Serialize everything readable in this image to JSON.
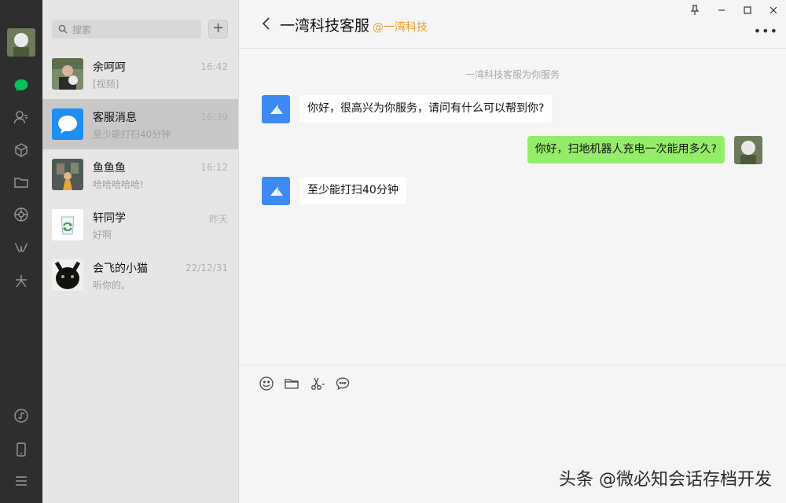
{
  "nav": {
    "icons": [
      "chat-icon",
      "contacts-icon",
      "box-icon",
      "folder-icon",
      "moments-icon",
      "channels-icon",
      "sparkle-icon",
      "mini-program-icon",
      "phone-icon",
      "menu-icon"
    ],
    "active_color": "#07c160"
  },
  "list": {
    "search_placeholder": "搜索",
    "add_label": "+",
    "items": [
      {
        "name": "余呵呵",
        "time": "16:42",
        "preview": "[视频]"
      },
      {
        "name": "客服消息",
        "time": "16:39",
        "preview": "至少能打扫40分钟"
      },
      {
        "name": "鱼鱼鱼",
        "time": "16:12",
        "preview": "哈哈哈哈哈!"
      },
      {
        "name": "轩同学",
        "time": "昨天",
        "preview": "好啊"
      },
      {
        "name": "会飞的小猫",
        "time": "22/12/31",
        "preview": "听你的。"
      }
    ]
  },
  "chat": {
    "title": "一湾科技客服",
    "org": "@一湾科技",
    "org_color": "#f39c2b",
    "system_note": "一湾科技客服为你服务",
    "messages": [
      {
        "from": "bot",
        "text": "你好，很高兴为你服务，请问有什么可以帮到你?"
      },
      {
        "from": "me",
        "text": "你好，扫地机器人充电一次能用多久?"
      },
      {
        "from": "bot",
        "text": "至少能打扫40分钟"
      }
    ],
    "bubble_out_color": "#95ec69"
  },
  "window": {
    "pin": "pin-icon",
    "minimize": "minimize-icon",
    "maximize": "maximize-icon",
    "close": "close-icon"
  },
  "watermark": "头条 @微必知会话存档开发"
}
